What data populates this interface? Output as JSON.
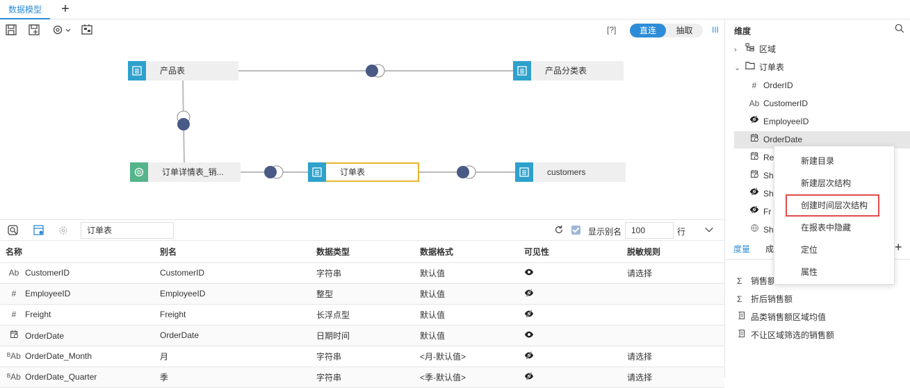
{
  "tabs": {
    "active": "数据模型",
    "add": "+"
  },
  "toolbar": {
    "help": "[?]",
    "mode_direct": "直连",
    "mode_extract": "抽取",
    "bars": "III"
  },
  "canvas": {
    "tables": {
      "product": "产品表",
      "category": "产品分类表",
      "detail": "订单详情表_销...",
      "orders": "订单表",
      "customers": "customers"
    }
  },
  "bottom_toolbar": {
    "table_name": "订单表",
    "show_alias_label": "显示别名",
    "rows_value": "100",
    "rows_unit": "行"
  },
  "grid": {
    "headers": [
      "名称",
      "别名",
      "数据类型",
      "数据格式",
      "可见性",
      "脱敏规则"
    ],
    "rows": [
      {
        "icon": "Ab",
        "name": "CustomerID",
        "alias": "CustomerID",
        "type": "字符串",
        "format": "默认值",
        "visible": "eye",
        "mask": "请选择"
      },
      {
        "icon": "#",
        "name": "EmployeeID",
        "alias": "EmployeeID",
        "type": "整型",
        "format": "默认值",
        "visible": "eye-slash",
        "mask": ""
      },
      {
        "icon": "#",
        "name": "Freight",
        "alias": "Freight",
        "type": "长浮点型",
        "format": "默认值",
        "visible": "eye-slash",
        "mask": ""
      },
      {
        "icon": "cal",
        "name": "OrderDate",
        "alias": "OrderDate",
        "type": "日期时间",
        "format": "默认值",
        "visible": "eye",
        "mask": ""
      },
      {
        "icon": "BAb",
        "name": "OrderDate_Month",
        "alias": "月",
        "type": "字符串",
        "format": "<月-默认值>",
        "visible": "eye-slash",
        "mask": "请选择"
      },
      {
        "icon": "BAb",
        "name": "OrderDate_Quarter",
        "alias": "季",
        "type": "字符串",
        "format": "<季-默认值>",
        "visible": "eye-slash",
        "mask": "请选择"
      }
    ]
  },
  "right_panel": {
    "title": "维度",
    "tree": [
      {
        "arrow": "›",
        "icon": "hier",
        "label": "区域"
      },
      {
        "arrow": "⌄",
        "icon": "folder",
        "label": "订单表"
      },
      {
        "arrow": "",
        "icon": "#",
        "label": "OrderID"
      },
      {
        "arrow": "",
        "icon": "Ab",
        "label": "CustomerID"
      },
      {
        "arrow": "",
        "icon": "eye-slash",
        "label": "EmployeeID"
      },
      {
        "arrow": "",
        "icon": "cal",
        "label": "OrderDate"
      },
      {
        "arrow": "",
        "icon": "cal",
        "label": "Re"
      },
      {
        "arrow": "",
        "icon": "cal",
        "label": "Sh"
      },
      {
        "arrow": "",
        "icon": "eye-slash",
        "label": "Sh"
      },
      {
        "arrow": "",
        "icon": "eye-slash",
        "label": "Fr"
      },
      {
        "arrow": "",
        "icon": "globe",
        "label": "Sh"
      }
    ],
    "measure_tab": "度量",
    "other_tab": "成",
    "add": "+",
    "measures": [
      {
        "icon": "Σ",
        "label": "销售额"
      },
      {
        "icon": "Σ",
        "label": "折后销售额"
      },
      {
        "icon": "calc",
        "label": "品类销售额区域均值"
      },
      {
        "icon": "calc",
        "label": "不让区域筛选的销售额"
      }
    ]
  },
  "context_menu": {
    "items": [
      "新建目录",
      "新建层次结构",
      "创建时间层次结构",
      "在报表中隐藏",
      "定位",
      "属性"
    ],
    "highlighted_index": 2
  }
}
